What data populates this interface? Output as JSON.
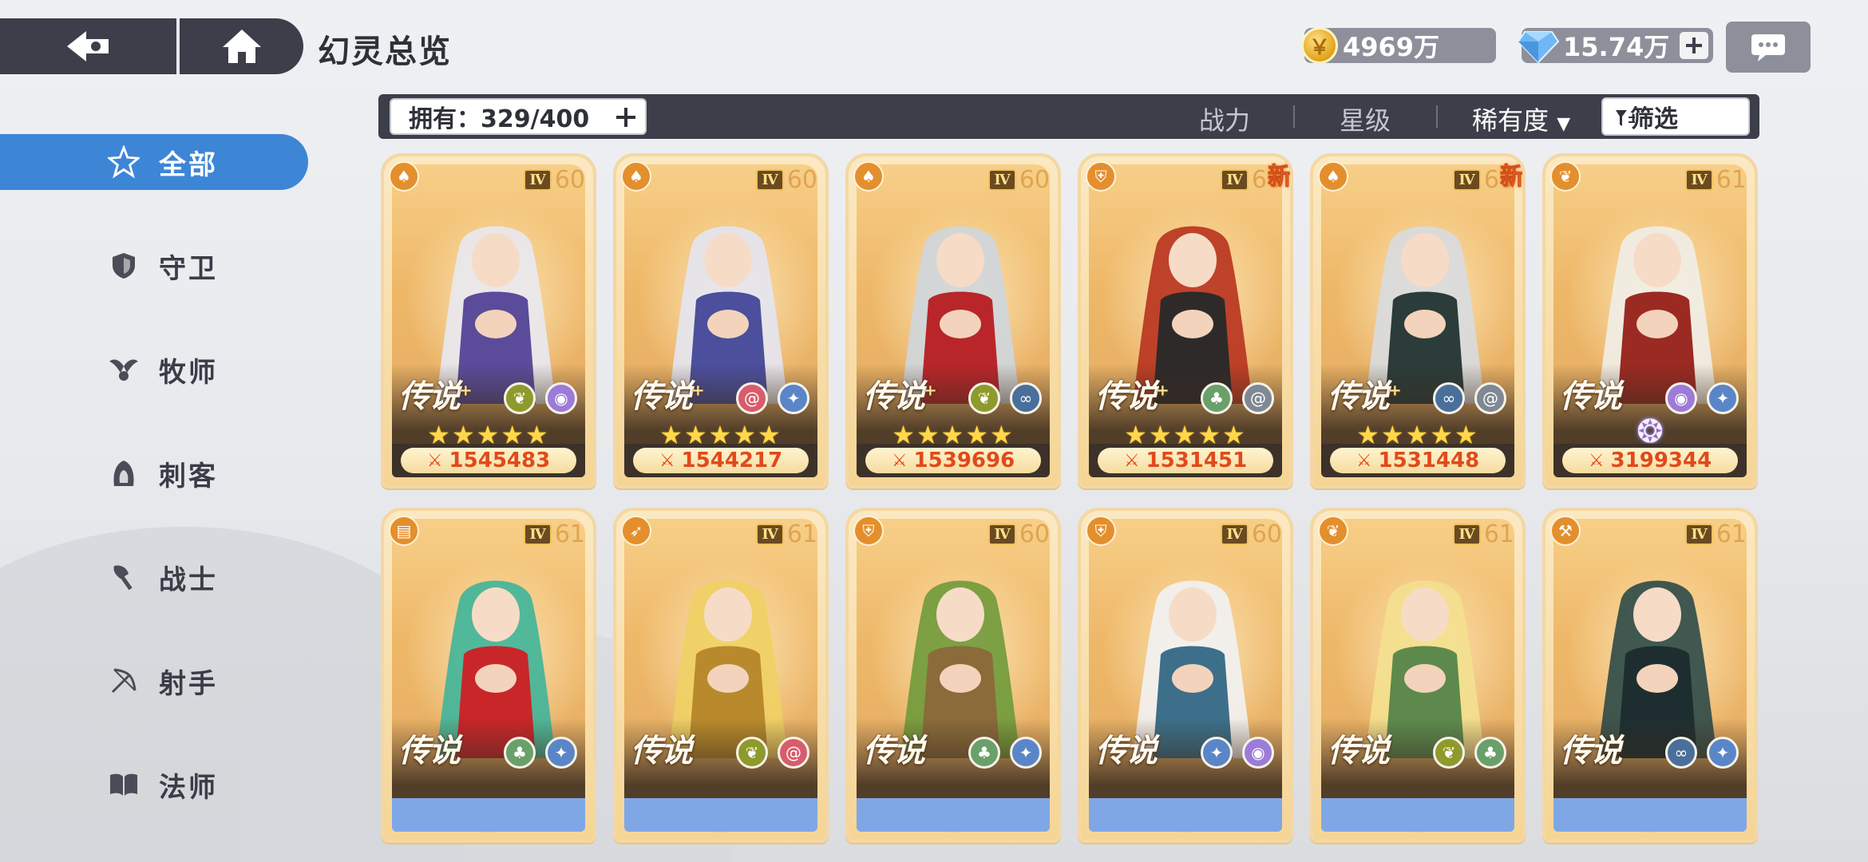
{
  "header": {
    "title": "幻灵总览",
    "gold": "4969万",
    "gems": "15.74万"
  },
  "sidebar": {
    "items": [
      {
        "label": "全部",
        "icon": "star-compass-icon",
        "active": true
      },
      {
        "label": "守卫",
        "icon": "shield-icon",
        "active": false
      },
      {
        "label": "牧师",
        "icon": "wings-icon",
        "active": false
      },
      {
        "label": "刺客",
        "icon": "hood-icon",
        "active": false
      },
      {
        "label": "战士",
        "icon": "axe-icon",
        "active": false
      },
      {
        "label": "射手",
        "icon": "bow-icon",
        "active": false
      },
      {
        "label": "法师",
        "icon": "book-icon",
        "active": false
      }
    ]
  },
  "filter": {
    "owned": "拥有：329/400",
    "sort_power": "战力",
    "sort_star": "星级",
    "sort_rarity": "稀有度",
    "screen": "筛选"
  },
  "colors": {
    "accent": "#3d86d6",
    "dark": "#3c3f4a",
    "power_text": "#e04a1c",
    "card_gold": "#f5d596"
  },
  "cards": [
    {
      "class_icon": "hood-icon",
      "rank": "Ⅳ",
      "level": "60",
      "rarity": "传说",
      "plus": "+",
      "is_new": false,
      "elements": [
        "wind-icon",
        "eye-icon"
      ],
      "stars": "★★★★★",
      "power": "1545483",
      "sword_icon": "⚔",
      "hair": "#e9e9f2",
      "outfit": "#5a4c9a"
    },
    {
      "class_icon": "hood-icon",
      "rank": "Ⅳ",
      "level": "60",
      "rarity": "传说",
      "plus": "+",
      "is_new": false,
      "elements": [
        "vortex-icon",
        "frost-icon"
      ],
      "stars": "★★★★★",
      "power": "1544217",
      "sword_icon": "⚔",
      "hair": "#e4e6f2",
      "outfit": "#4b4f9c"
    },
    {
      "class_icon": "hood-icon",
      "rank": "Ⅳ",
      "level": "60",
      "rarity": "传说",
      "plus": "+",
      "is_new": false,
      "elements": [
        "wind-icon",
        "void-icon"
      ],
      "stars": "★★★★★",
      "power": "1539696",
      "sword_icon": "⚔",
      "hair": "#cfd6de",
      "outfit": "#b8262a"
    },
    {
      "class_icon": "shield-icon",
      "rank": "Ⅳ",
      "level": "60",
      "rarity": "传说",
      "plus": "+",
      "is_new": true,
      "new_label": "新",
      "elements": [
        "leaf-icon",
        "spiral-icon"
      ],
      "stars": "★★★★★",
      "power": "1531451",
      "sword_icon": "⚔",
      "hair": "#b8321e",
      "outfit": "#2e2a2a"
    },
    {
      "class_icon": "hood-icon",
      "rank": "Ⅳ",
      "level": "60",
      "rarity": "传说",
      "plus": "+",
      "is_new": true,
      "new_label": "新",
      "elements": [
        "void-icon",
        "spiral-icon"
      ],
      "stars": "★★★★★",
      "power": "1531448",
      "sword_icon": "⚔",
      "hair": "#d8dbe0",
      "outfit": "#2b3c3a"
    },
    {
      "class_icon": "wings-icon",
      "rank": "Ⅳ",
      "level": "61",
      "rarity": "传说",
      "plus": "",
      "is_new": false,
      "elements": [
        "eye-icon",
        "frost-icon"
      ],
      "stars": "",
      "power": "3199344",
      "sword_icon": "⚔",
      "hair": "#f1eee8",
      "outfit": "#9b2a22"
    },
    {
      "class_icon": "book-icon",
      "rank": "Ⅳ",
      "level": "61",
      "rarity": "传说",
      "plus": "",
      "is_new": false,
      "elements": [
        "leaf-icon",
        "frost-icon"
      ],
      "stars": "",
      "power": "",
      "sword_icon": "",
      "hair": "#3fb59a",
      "outfit": "#c9262a"
    },
    {
      "class_icon": "bow-icon",
      "rank": "Ⅳ",
      "level": "61",
      "rarity": "传说",
      "plus": "",
      "is_new": false,
      "elements": [
        "wind-icon",
        "vortex-icon"
      ],
      "stars": "",
      "power": "",
      "sword_icon": "",
      "hair": "#f0d064",
      "outfit": "#b98a2c"
    },
    {
      "class_icon": "shield-icon",
      "rank": "Ⅳ",
      "level": "60",
      "rarity": "传说",
      "plus": "",
      "is_new": false,
      "elements": [
        "leaf-icon",
        "frost-icon"
      ],
      "stars": "",
      "power": "",
      "sword_icon": "",
      "hair": "#6f9a3a",
      "outfit": "#8b6b3a"
    },
    {
      "class_icon": "shield-icon",
      "rank": "Ⅳ",
      "level": "60",
      "rarity": "传说",
      "plus": "",
      "is_new": false,
      "elements": [
        "frost-icon",
        "eye-icon"
      ],
      "stars": "",
      "power": "",
      "sword_icon": "",
      "hair": "#f2f2f4",
      "outfit": "#3d6f8a"
    },
    {
      "class_icon": "wings-icon",
      "rank": "Ⅳ",
      "level": "61",
      "rarity": "传说",
      "plus": "",
      "is_new": false,
      "elements": [
        "wind-icon",
        "leaf-icon"
      ],
      "stars": "",
      "power": "",
      "sword_icon": "",
      "hair": "#f4e08f",
      "outfit": "#5d8a4c"
    },
    {
      "class_icon": "axe-icon",
      "rank": "Ⅳ",
      "level": "61",
      "rarity": "传说",
      "plus": "",
      "is_new": false,
      "elements": [
        "void-icon",
        "frost-icon"
      ],
      "stars": "",
      "power": "",
      "sword_icon": "",
      "hair": "#2c4a48",
      "outfit": "#1e2e30"
    }
  ]
}
